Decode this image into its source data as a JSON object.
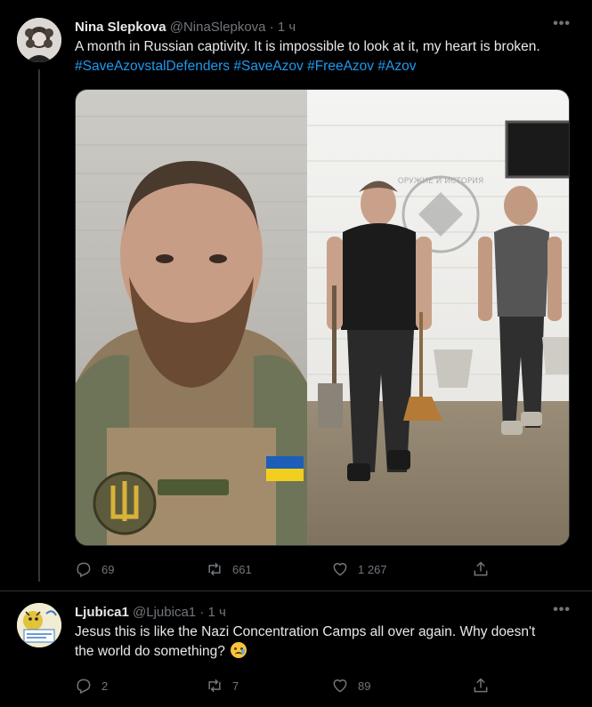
{
  "tweets": [
    {
      "author_name": "Nina Slepkova",
      "handle": "@NinaSlepkova",
      "separator": "·",
      "time": "1 ч",
      "text_plain": "A month in Russian captivity.  It is impossible to look at it, my heart is broken.",
      "hashtags": [
        "#SaveAzovstalDefenders",
        "#SaveAzov",
        "#FreeAzov",
        "#Azov"
      ],
      "media_watermark": "ОРУЖИЕ И ИСТОРИЯ",
      "replies": "69",
      "retweets": "661",
      "likes": "1 267",
      "more_label": "•••"
    },
    {
      "author_name": "Ljubica1",
      "handle": "@Ljubica1",
      "separator": "·",
      "time": "1 ч",
      "text_plain": "Jesus this is like the Nazi Concentration Camps all over again. Why doesn't the world do something?",
      "replies": "2",
      "retweets": "7",
      "likes": "89",
      "more_label": "•••"
    }
  ],
  "icons": [
    "more-icon",
    "reply-icon",
    "retweet-icon",
    "like-icon",
    "share-icon",
    "crying-face-emoji"
  ],
  "colors": {
    "background": "#000000",
    "text": "#e7e9ea",
    "muted": "#71767b",
    "link": "#1d9bf0",
    "divider": "#2f3336"
  }
}
